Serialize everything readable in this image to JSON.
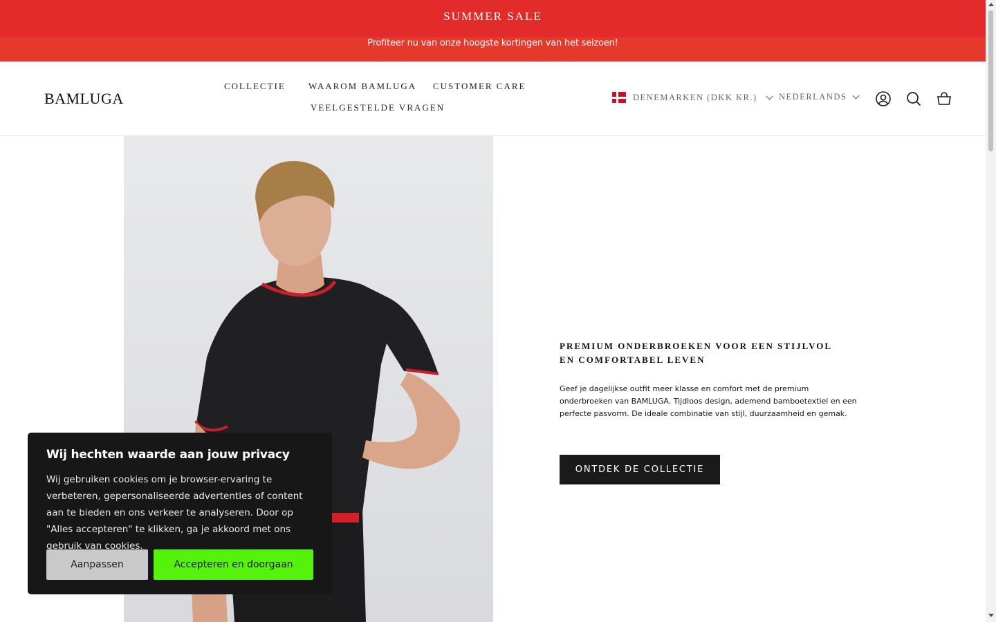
{
  "announcement": {
    "title": "SUMMER SALE",
    "subtitle": "Profiteer nu van onze hoogste kortingen van het seizoen!",
    "background_color": "#e32b2b"
  },
  "header": {
    "logo": "BAMLUGA",
    "nav": [
      {
        "label": "COLLECTIE"
      },
      {
        "label": "WAAROM BAMLUGA"
      },
      {
        "label": "CUSTOMER CARE"
      },
      {
        "label": "VEELGESTELDE VRAGEN"
      }
    ],
    "country_selector": {
      "value": "DENEMARKEN (DKK KR.)",
      "flag": "denmark-flag-icon"
    },
    "language_selector": {
      "value": "NEDERLANDS"
    },
    "icons": [
      "account-icon",
      "search-icon",
      "cart-icon"
    ]
  },
  "hero": {
    "title": "PREMIUM ONDERBROEKEN VOOR EEN STIJLVOL EN COMFORTABEL LEVEN",
    "description": "Geef je dagelijkse outfit meer klasse en comfort met de premium onderbroeken van BAMLUGA. Tijdloos design, ademend bamboetextiel en een perfecte pasvorm. De ideale combinatie van stijl, duurzaamheid en gemak.",
    "cta_label": "ONTDEK DE COLLECTIE"
  },
  "cookie_banner": {
    "title": "Wij hechten waarde aan jouw privacy",
    "text": "Wij gebruiken cookies om je browser-ervaring te verbeteren, gepersonaliseerde advertenties of content aan te bieden en ons verkeer te analyseren. Door op \"Alles accepteren\" te klikken, ga je akkoord met ons gebruik van cookies.",
    "adjust_label": "Aanpassen",
    "accept_label": "Accepteren en doorgaan",
    "accept_color": "#55f30c"
  }
}
